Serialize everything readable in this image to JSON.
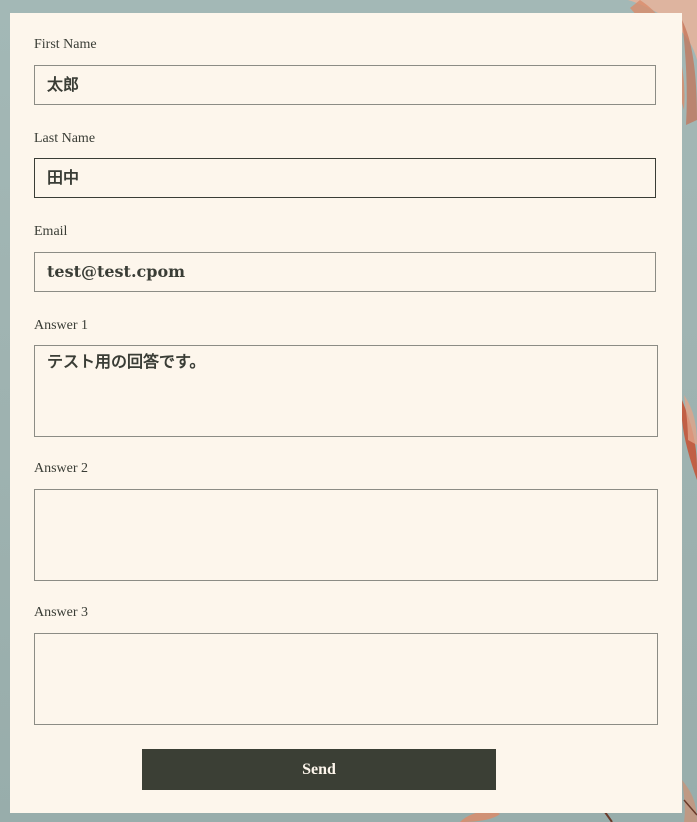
{
  "form": {
    "first_name": {
      "label": "First Name",
      "value": "太郎"
    },
    "last_name": {
      "label": "Last Name",
      "value": "田中"
    },
    "email": {
      "label": "Email",
      "value": "test@test.cpom"
    },
    "answer1": {
      "label": "Answer 1",
      "value": "テスト用の回答です。"
    },
    "answer2": {
      "label": "Answer 2",
      "value": ""
    },
    "answer3": {
      "label": "Answer 3",
      "value": ""
    },
    "send_label": "Send"
  },
  "colors": {
    "background": "#a3b8b6",
    "card": "#fdf6ec",
    "text": "#3a3d36",
    "border": "#8c8c85",
    "button": "#3b3f35",
    "button_text": "#fdf6ec",
    "floral_accent": "#d98c6b"
  },
  "decorations": {
    "background_icon": "floral-illustration-icon"
  }
}
